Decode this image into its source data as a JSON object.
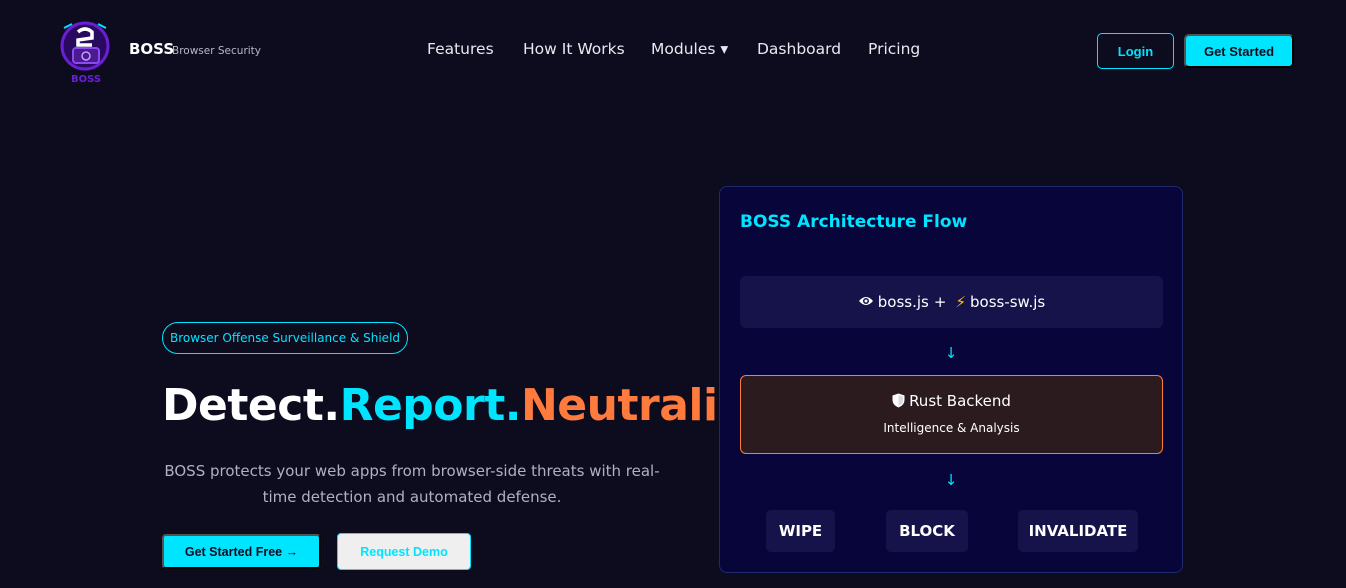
{
  "header": {
    "brand_name": "BOSS",
    "brand_sub": "Browser Security",
    "logo_text": "BOSS",
    "nav": [
      {
        "label": "Features"
      },
      {
        "label": "How It Works"
      },
      {
        "label": "Modules ▾"
      },
      {
        "label": "Dashboard"
      },
      {
        "label": "Pricing"
      }
    ],
    "login_label": "Login",
    "get_started_label": "Get Started"
  },
  "hero": {
    "badge": "Browser Offense Surveillance & Shield",
    "headline": [
      "Detect.",
      "Report.",
      "Neutralize."
    ],
    "description": "BOSS protects your web apps from browser-side threats with real-time detection and automated defense.",
    "cta_primary": "Get Started Free →",
    "cta_secondary": "Request Demo"
  },
  "architecture": {
    "title": "BOSS Architecture Flow",
    "client_scripts": [
      "boss.js",
      "boss-sw.js"
    ],
    "client_separator": "+",
    "arrow": "↓",
    "backend_title": "Rust Backend",
    "backend_sub": "Intelligence & Analysis",
    "actions": [
      "WIPE",
      "BLOCK",
      "INVALIDATE"
    ]
  },
  "colors": {
    "background": "#0d0b1e",
    "accent_cyan": "#00e5ff",
    "accent_orange": "#ff7a3d",
    "card_bg": "#07053a",
    "logo_purple": "#6a1fd6"
  },
  "icons": [
    "boss-logo-icon",
    "eye-icon",
    "lightning-icon",
    "shield-icon"
  ]
}
